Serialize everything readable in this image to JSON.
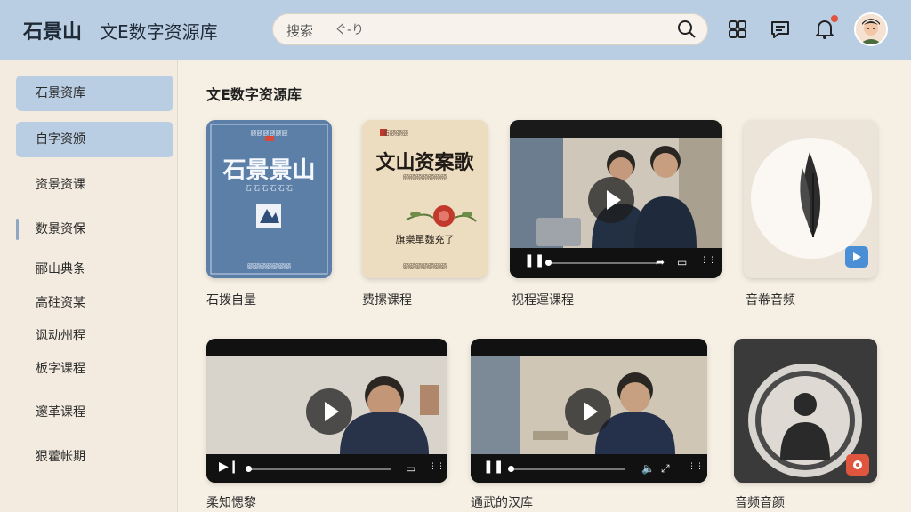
{
  "header": {
    "brand": "石景山",
    "app_name": "文E数字资源库",
    "search_label": "搜索",
    "search_value": "ぐ-り",
    "icons": [
      "search-icon",
      "grid-icon",
      "message-icon",
      "bell-icon"
    ]
  },
  "sidebar": {
    "items": [
      {
        "label": "石景资库"
      },
      {
        "label": "自字资颁"
      },
      {
        "label": "资景资课"
      },
      {
        "label": "数景资保"
      },
      {
        "label": "郦山典条"
      },
      {
        "label": "高砫资某"
      },
      {
        "label": "讽动州程"
      },
      {
        "label": "板字课程"
      },
      {
        "label": "邃革课程"
      },
      {
        "label": "狠藿帐期"
      }
    ]
  },
  "main": {
    "section_title": "文E数字资源库",
    "cards": [
      {
        "label": "石拨自量",
        "type": "book",
        "cover_title": "石景景山",
        "cover_top": "颐颐颐颐颐颐",
        "cover_sub": "石 石 石 石 石 石",
        "cover_bottom": "颐颐颐颐颐颐颐"
      },
      {
        "label": "费摞课程",
        "type": "book",
        "cover_title": "文山资案歌",
        "cover_top": "石颐颐颐",
        "cover_sub": "颐颐颐颐颐颐颐",
        "cover_mid": "旗樂單魏充了",
        "cover_bottom": "颐颐颐颐颐颐颐"
      },
      {
        "label": "视程運课程",
        "type": "video"
      },
      {
        "label": "音帣音频",
        "type": "audio"
      },
      {
        "label": "柔知愢黎",
        "type": "video"
      },
      {
        "label": "通武的汉库",
        "type": "video"
      },
      {
        "label": "音频音颜",
        "type": "audio"
      }
    ]
  },
  "colors": {
    "header_bg": "#b9cde3",
    "sidebar_active": "#b9cde3",
    "page_bg": "#f6efe4",
    "badge_red": "#e0553d",
    "badge_blue": "#4a8fd6"
  }
}
